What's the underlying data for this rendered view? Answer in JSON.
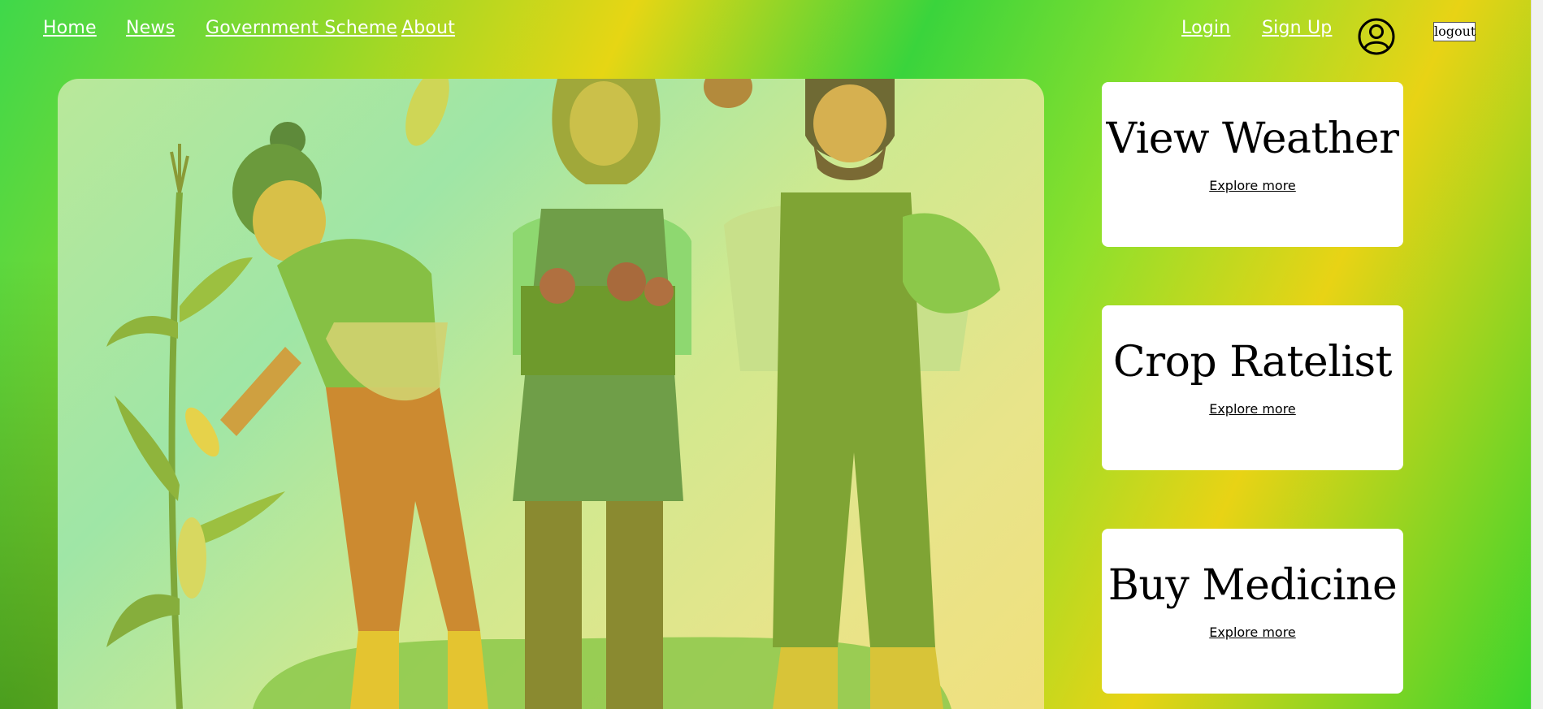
{
  "nav": {
    "home": "Home",
    "news": "News",
    "scheme": "Government Scheme",
    "about": "About",
    "login": "Login",
    "signup": "Sign Up",
    "logout": "logout"
  },
  "cards": [
    {
      "title": "View Weather",
      "link": "Explore more"
    },
    {
      "title": "Crop Ratelist",
      "link": "Explore more"
    },
    {
      "title": "Buy Medicine",
      "link": "Explore more"
    }
  ],
  "icons": {
    "profile": "user-circle-icon"
  },
  "colors": {
    "accent_green": "#3fd84a",
    "accent_yellow": "#e6d614",
    "card_bg": "#ffffff"
  }
}
